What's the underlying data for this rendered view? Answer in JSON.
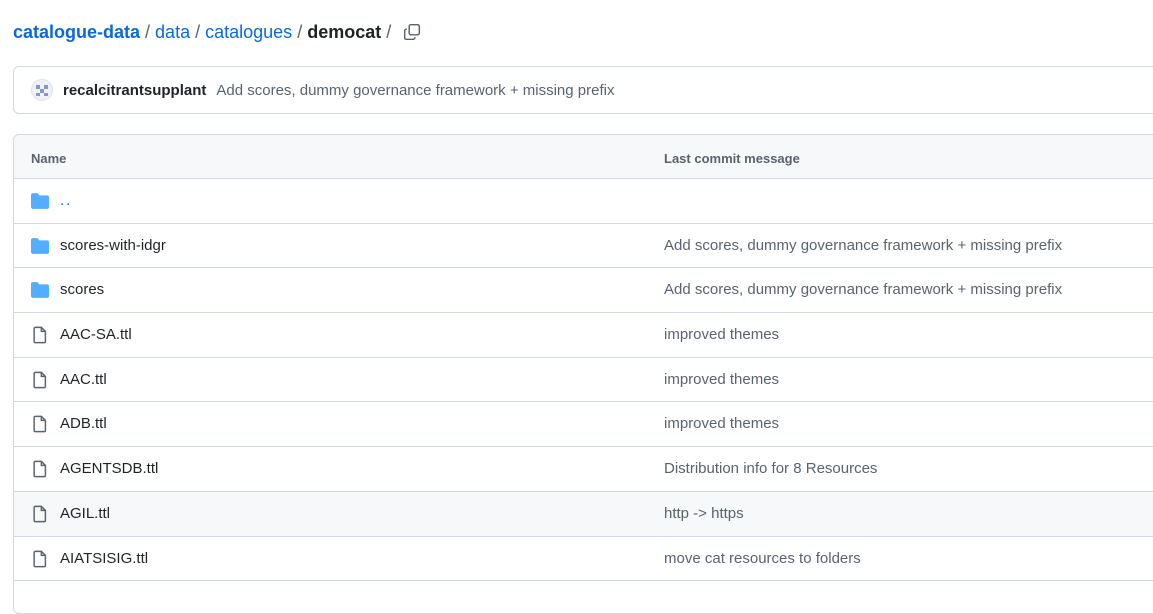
{
  "breadcrumb": {
    "items": [
      "catalogue-data",
      "data",
      "catalogues"
    ],
    "separator": "/",
    "current": "democat",
    "trailing": "/"
  },
  "commit": {
    "author": "recalcitrantsupplant",
    "message": "Add scores, dummy governance framework + missing prefix"
  },
  "table": {
    "header_name": "Name",
    "header_message": "Last commit message",
    "rows": [
      {
        "type": "folder",
        "name": "..",
        "message": ""
      },
      {
        "type": "folder",
        "name": "scores-with-idgr",
        "message": "Add scores, dummy governance framework + missing prefix"
      },
      {
        "type": "folder",
        "name": "scores",
        "message": "Add scores, dummy governance framework + missing prefix"
      },
      {
        "type": "file",
        "name": "AAC-SA.ttl",
        "message": "improved themes"
      },
      {
        "type": "file",
        "name": "AAC.ttl",
        "message": "improved themes"
      },
      {
        "type": "file",
        "name": "ADB.ttl",
        "message": "improved themes"
      },
      {
        "type": "file",
        "name": "AGENTSDB.ttl",
        "message": "Distribution info for 8 Resources"
      },
      {
        "type": "file",
        "name": "AGIL.ttl",
        "message": "http -> https"
      },
      {
        "type": "file",
        "name": "AIATSISIG.ttl",
        "message": "move cat resources to folders"
      }
    ]
  },
  "colors": {
    "link": "#0969da",
    "folder_icon": "#54aeff",
    "file_icon": "#59636e",
    "border": "#d1d9e0"
  },
  "icons": {
    "copy": "copy-icon",
    "folder": "folder-icon",
    "file": "file-icon"
  }
}
